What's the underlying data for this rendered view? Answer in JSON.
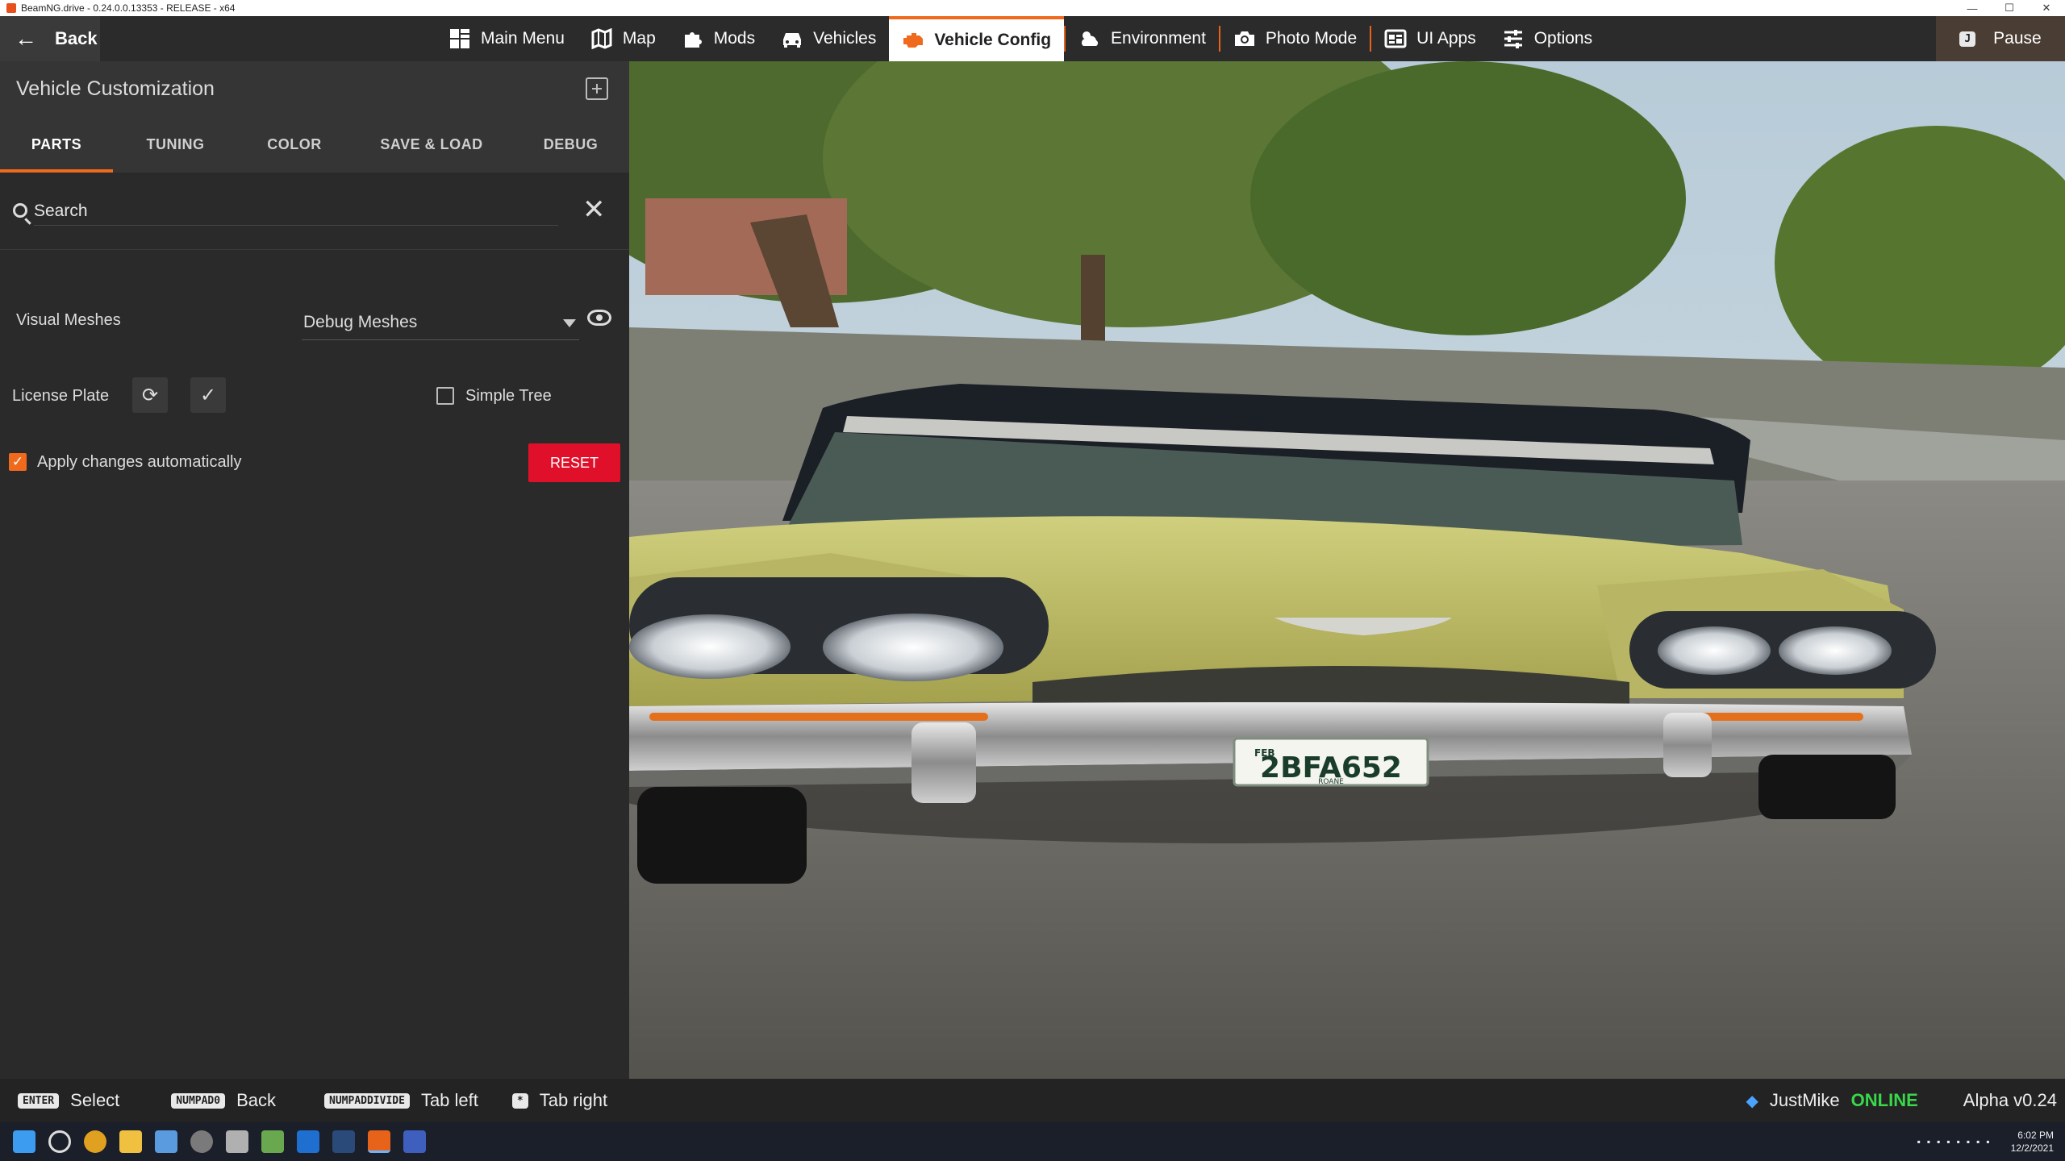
{
  "window": {
    "title": "BeamNG.drive - 0.24.0.0.13353 - RELEASE - x64",
    "minimize": "—",
    "maximize": "☐",
    "close": "✕"
  },
  "topbar": {
    "back_label": "Back",
    "items": [
      {
        "label": "Main Menu",
        "icon": "grid-icon"
      },
      {
        "label": "Map",
        "icon": "map-icon"
      },
      {
        "label": "Mods",
        "icon": "puzzle-icon"
      },
      {
        "label": "Vehicles",
        "icon": "car-icon"
      },
      {
        "label": "Vehicle Config",
        "icon": "engine-icon"
      },
      {
        "label": "Environment",
        "icon": "weather-icon"
      },
      {
        "label": "Photo Mode",
        "icon": "camera-icon"
      },
      {
        "label": "UI Apps",
        "icon": "apps-icon"
      },
      {
        "label": "Options",
        "icon": "sliders-icon"
      }
    ],
    "active": "Vehicle Config",
    "pause_label": "Pause",
    "pause_key": "J",
    "accent": "#f06a1e"
  },
  "panel": {
    "title": "Vehicle Customization",
    "tabs": [
      "PARTS",
      "TUNING",
      "COLOR",
      "SAVE & LOAD",
      "DEBUG"
    ],
    "active_tab": "PARTS",
    "search_placeholder": "Search",
    "visual_meshes_label": "Visual Meshes",
    "visual_meshes_value": "Debug Meshes",
    "license_plate_label": "License Plate",
    "simple_tree_label": "Simple Tree",
    "simple_tree_checked": false,
    "apply_auto_label": "Apply changes automatically",
    "apply_auto_checked": true,
    "reset_label": "RESET",
    "reset_color": "#e0102a"
  },
  "viewport": {
    "plate_text": "2BFA652",
    "plate_month": "FEB",
    "plate_county": "ROANE"
  },
  "hints": [
    {
      "key": "ENTER",
      "label": "Select"
    },
    {
      "key": "NUMPAD0",
      "label": "Back"
    },
    {
      "key": "NUMPADDIVIDE",
      "label": "Tab left"
    },
    {
      "key": "*",
      "label": "Tab right"
    }
  ],
  "status": {
    "user": "JustMike",
    "state": "ONLINE",
    "version": "Alpha v0.24"
  },
  "taskbar": {
    "time": "6:02 PM",
    "date": "12/2/2021"
  }
}
